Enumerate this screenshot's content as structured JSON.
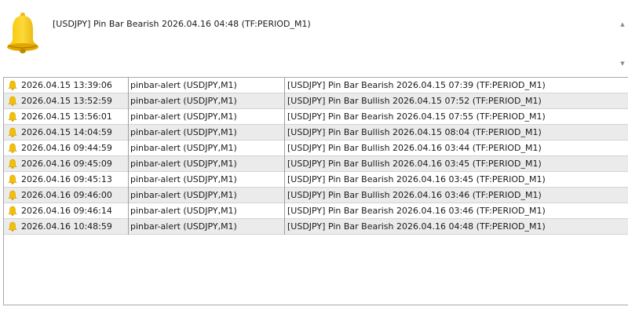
{
  "alert": {
    "message": "[USDJPY] Pin Bar Bearish 2026.04.16 04:48 (TF:PERIOD_M1)",
    "icon": "bell-icon",
    "bell_color": "#f5c000"
  },
  "list": {
    "rows": [
      {
        "time": "2026.04.15 13:39:06",
        "source": "pinbar-alert (USDJPY,M1)",
        "message": "[USDJPY] Pin Bar Bearish 2026.04.15 07:39 (TF:PERIOD_M1)"
      },
      {
        "time": "2026.04.15 13:52:59",
        "source": "pinbar-alert (USDJPY,M1)",
        "message": "[USDJPY] Pin Bar Bullish 2026.04.15 07:52 (TF:PERIOD_M1)"
      },
      {
        "time": "2026.04.15 13:56:01",
        "source": "pinbar-alert (USDJPY,M1)",
        "message": "[USDJPY] Pin Bar Bearish 2026.04.15 07:55 (TF:PERIOD_M1)"
      },
      {
        "time": "2026.04.15 14:04:59",
        "source": "pinbar-alert (USDJPY,M1)",
        "message": "[USDJPY] Pin Bar Bullish 2026.04.15 08:04 (TF:PERIOD_M1)"
      },
      {
        "time": "2026.04.16 09:44:59",
        "source": "pinbar-alert (USDJPY,M1)",
        "message": "[USDJPY] Pin Bar Bullish 2026.04.16 03:44 (TF:PERIOD_M1)"
      },
      {
        "time": "2026.04.16 09:45:09",
        "source": "pinbar-alert (USDJPY,M1)",
        "message": "[USDJPY] Pin Bar Bullish 2026.04.16 03:45 (TF:PERIOD_M1)"
      },
      {
        "time": "2026.04.16 09:45:13",
        "source": "pinbar-alert (USDJPY,M1)",
        "message": "[USDJPY] Pin Bar Bearish 2026.04.16 03:45 (TF:PERIOD_M1)"
      },
      {
        "time": "2026.04.16 09:46:00",
        "source": "pinbar-alert (USDJPY,M1)",
        "message": "[USDJPY] Pin Bar Bullish 2026.04.16 03:46 (TF:PERIOD_M1)"
      },
      {
        "time": "2026.04.16 09:46:14",
        "source": "pinbar-alert (USDJPY,M1)",
        "message": "[USDJPY] Pin Bar Bearish 2026.04.16 03:46 (TF:PERIOD_M1)"
      },
      {
        "time": "2026.04.16 10:48:59",
        "source": "pinbar-alert (USDJPY,M1)",
        "message": "[USDJPY] Pin Bar Bearish 2026.04.16 04:48 (TF:PERIOD_M1)"
      }
    ]
  },
  "colors": {
    "row_alt": "#ebebeb",
    "row_plain": "#ffffff",
    "bell": "#f5c000"
  }
}
